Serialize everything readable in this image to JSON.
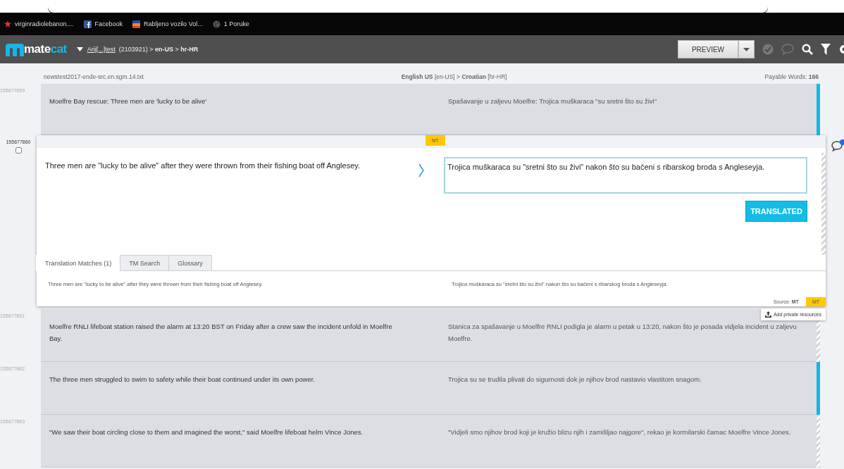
{
  "browser": {
    "bookmarks": [
      {
        "label": "virginradiolebanon....",
        "kind": "star"
      },
      {
        "label": "Facebook",
        "kind": "facebook"
      },
      {
        "label": "Rabljeno vozilo Vol...",
        "kind": "flag"
      },
      {
        "label": "1 Poruke",
        "kind": "globe"
      }
    ]
  },
  "header": {
    "logo": {
      "primary": "mate",
      "accent": "cat"
    },
    "project_link": "Arij[...]test",
    "job_info": "(2103921) > **en-US** > **hr-HR**",
    "preview_button": "PREVIEW"
  },
  "file_bar": {
    "filename": "newstest2017-ende-src.en.sgm.14.txt",
    "languages": "**English US** [en-US] > **Croatian** [hr-HR]",
    "payable_words": "Payable Words: **166**"
  },
  "segments": [
    {
      "id": "155677859",
      "source": "Moelfre Bay rescue: Three men are 'lucky to be alive'",
      "target": "Spašavanje u zaljevu Moelfre: Trojica muškaraca  \"su sretni što su živi\"",
      "translated": true
    },
    {
      "id": "155677860",
      "source": "Three men are \"lucky to be alive\" after they were thrown from their fishing boat off Anglesey.",
      "target": "Trojica muškaraca su \"sretni što su živi\" nakon što su bačeni s ribarskog broda s Angleseyja.",
      "translated": false,
      "editor": {
        "checked": false,
        "badge": "MT",
        "button": "TRANSLATED",
        "tabs": [
          {
            "label": "Translation Matches (1)",
            "selected": true
          },
          {
            "label": "TM Search",
            "selected": false
          },
          {
            "label": "Glossary",
            "selected": false
          }
        ],
        "match_source": "Three men are \"lucky to be alive\" after they were thrown from their fishing boat off Anglesey.",
        "match_target": "Trojica muškaraca su \"sretni što su živi\" nakon što su bačeni s ribarskog broda s Angleseyja.",
        "match_origin": "Source: **MT**",
        "match_badge": "MT",
        "popup": "Add private resources"
      }
    },
    {
      "id": "155677861",
      "source": "Moelfre RNLI lifeboat station raised the alarm at 13:20 BST on Friday after a crew saw the incident unfold in Moelfre Bay.",
      "target": "Stanica za spašavanje u Moelfre RNLI podigla je alarm u petak u 13:20, nakon što je posada vidjela incident u zaljevu Moelfre.",
      "translated": false
    },
    {
      "id": "155677862",
      "source": "The three men struggled to swim to safety while their boat continued under its own power.",
      "target": "Trojica su se trudila plivati do sigurnosti dok je njihov brod nastavio vlastitom snagom.",
      "translated": true
    },
    {
      "id": "155677863",
      "source": "\"We saw their boat circling close to them and imagined the worst,\" said Moelfre lifeboat helm Vince Jones.",
      "target": "\"Vidjeli smo njihov brod koji je kružio blizu njih i zamišljao najgore\", rekao je kormilarski čamac Moelfre Vince Jones.",
      "translated": false
    }
  ]
}
